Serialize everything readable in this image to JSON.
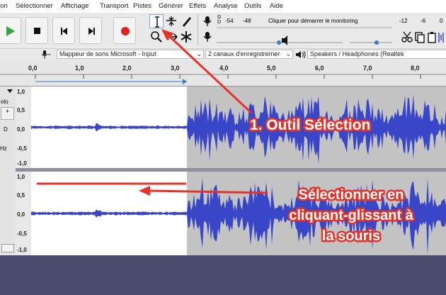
{
  "menu": [
    "ion",
    "Sélectionner",
    "Affichage",
    "Transport",
    "Pistes",
    "Générer",
    "Effets",
    "Analyse",
    "Outils",
    "Aide"
  ],
  "meter": {
    "playback_label": "G\nD",
    "record_scale": [
      "-54",
      "-48"
    ],
    "monitor_prompt": "Cliquer pour démarrer le monitoring",
    "right_scale": [
      "-12",
      "-6",
      "0"
    ]
  },
  "device_bar": {
    "input_device": "Mappeur de sons Microsoft - Input",
    "channels": "2 canaux d'enregistremer",
    "output_device": "Speakers / Headphones (Realtek"
  },
  "ruler": {
    "ticks": [
      "0,0",
      "1,0",
      "2,0",
      "3,0",
      "4,0",
      "5,0",
      "6,0",
      "7,0",
      "8,0"
    ]
  },
  "track": {
    "control_label": "olo",
    "d_label": "D",
    "rate_label": "Hz"
  },
  "scale": [
    "1,0",
    "0,5",
    "0,0",
    "-0,5",
    "-1,0"
  ],
  "annotations": {
    "tool_selection": "1. Outil Sélection",
    "select_line1": "Sélectionner en",
    "select_line2": "cliquant-glissant à",
    "select_line3": "la souris"
  },
  "colors": {
    "waveform": "#3a46c8",
    "selected_bg": "#ffffff",
    "unselected_bg": "#c3c3c3",
    "annotation": "#e6332a"
  }
}
